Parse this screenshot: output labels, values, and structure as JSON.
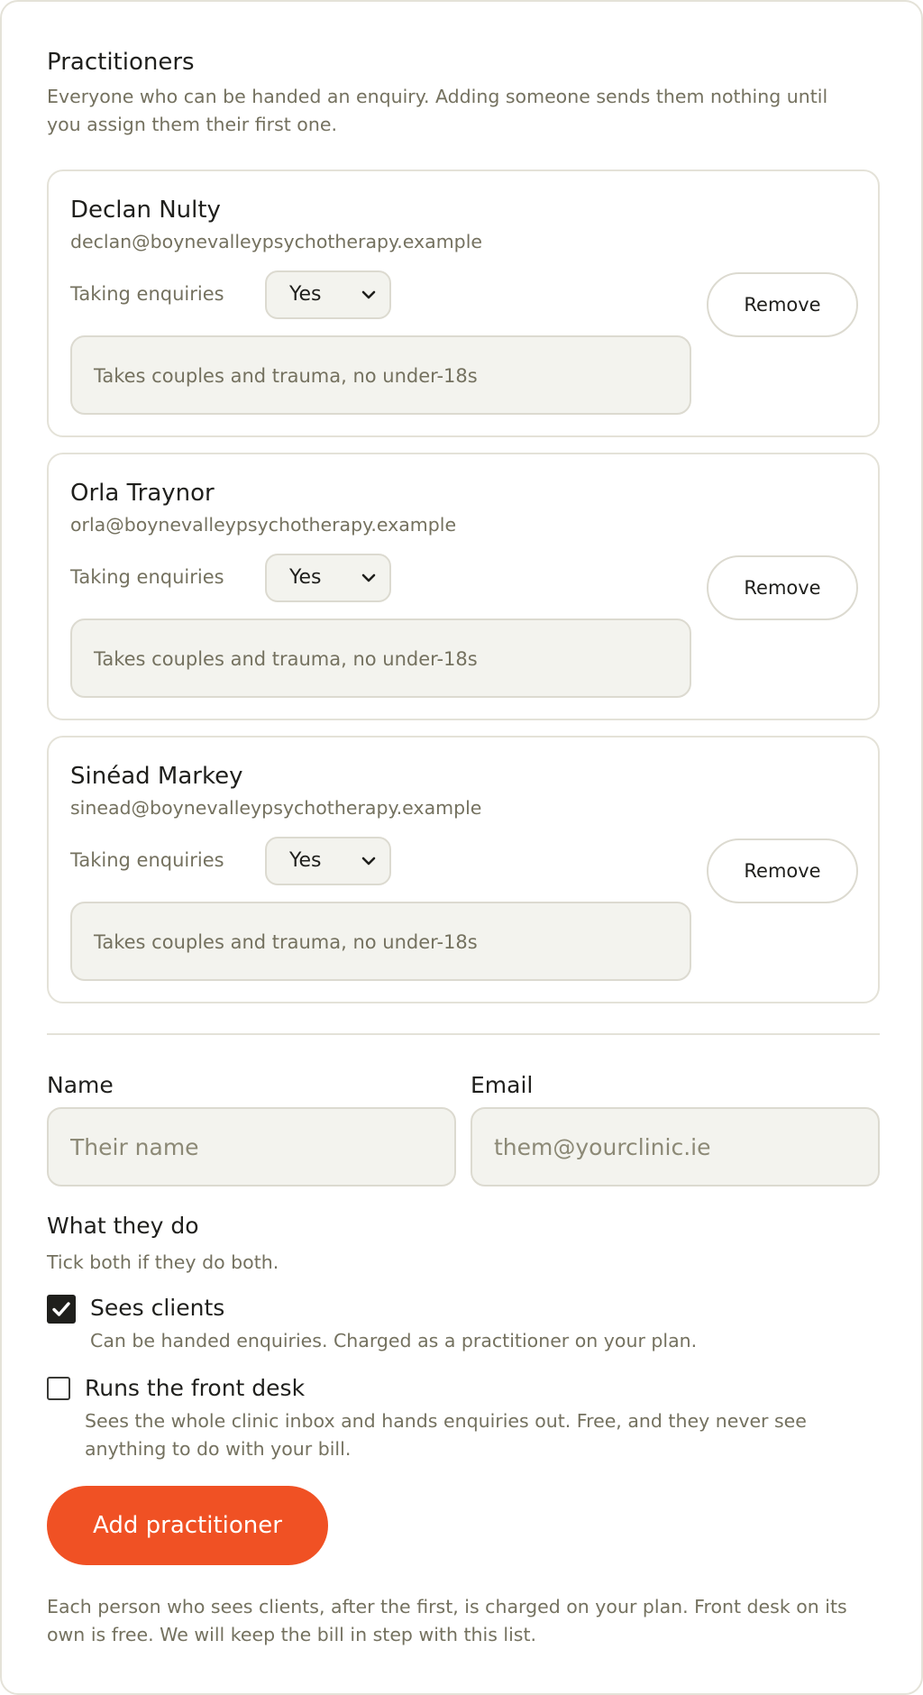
{
  "section": {
    "title": "Practitioners",
    "description": "Everyone who can be handed an enquiry. Adding someone sends them nothing until you assign them their first one."
  },
  "practitioners": [
    {
      "name": "Declan Nulty",
      "email": "declan@boynevalleypsychotherapy.example",
      "taking_label": "Taking enquiries",
      "taking_value": "Yes",
      "note": "Takes couples and trauma, no under-18s",
      "remove_label": "Remove"
    },
    {
      "name": "Orla Traynor",
      "email": "orla@boynevalleypsychotherapy.example",
      "taking_label": "Taking enquiries",
      "taking_value": "Yes",
      "note": "Takes couples and trauma, no under-18s",
      "remove_label": "Remove"
    },
    {
      "name": "Sinéad Markey",
      "email": "sinead@boynevalleypsychotherapy.example",
      "taking_label": "Taking enquiries",
      "taking_value": "Yes",
      "note": "Takes couples and trauma, no under-18s",
      "remove_label": "Remove"
    }
  ],
  "form": {
    "name_label": "Name",
    "name_placeholder": "Their name",
    "email_label": "Email",
    "email_placeholder": "them@yourclinic.ie",
    "what_title": "What they do",
    "what_hint": "Tick both if they do both.",
    "roles": [
      {
        "title": "Sees clients",
        "description": "Can be handed enquiries. Charged as a practitioner on your plan.",
        "checked": true
      },
      {
        "title": "Runs the front desk",
        "description": "Sees the whole clinic inbox and hands enquiries out. Free, and they never see anything to do with your bill.",
        "checked": false
      }
    ],
    "submit_label": "Add practitioner"
  },
  "footer_note": "Each person who sees clients, after the first, is charged on your plan. Front desk on its own is free. We will keep the bill in step with this list.",
  "icons": {
    "select_chevron": "chevron-down-icon",
    "checkbox_checked": "checkmark-icon"
  },
  "colors": {
    "accent": "#f05124",
    "text": "#1f1f1c",
    "muted_text": "#74715f",
    "field_bg": "#f3f3ee",
    "border": "#e4e2d8"
  }
}
